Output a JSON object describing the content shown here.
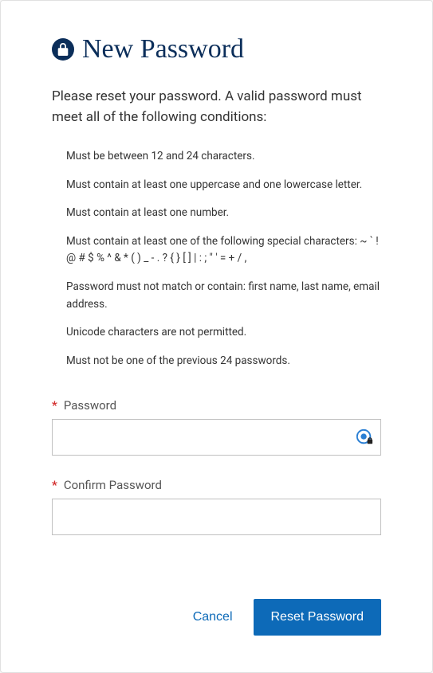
{
  "header": {
    "title": "New Password"
  },
  "intro": "Please reset your password. A valid password must meet all of the following conditions:",
  "rules": [
    "Must be between 12 and 24 characters.",
    "Must contain at least one uppercase and one lowercase letter.",
    "Must contain at least one number.",
    "Must contain at least one of the following special characters: ~ ` ! @ # $ % ^ & * ( ) _ - . ? { } [ ] | : ; \" ' = + / ,",
    "Password must not match or contain: first name, last name, email address.",
    "Unicode characters are not permitted.",
    "Must not be one of the previous 24 passwords."
  ],
  "fields": {
    "password": {
      "label": "Password",
      "value": ""
    },
    "confirm": {
      "label": "Confirm Password",
      "value": ""
    }
  },
  "actions": {
    "cancel": "Cancel",
    "submit": "Reset Password"
  }
}
